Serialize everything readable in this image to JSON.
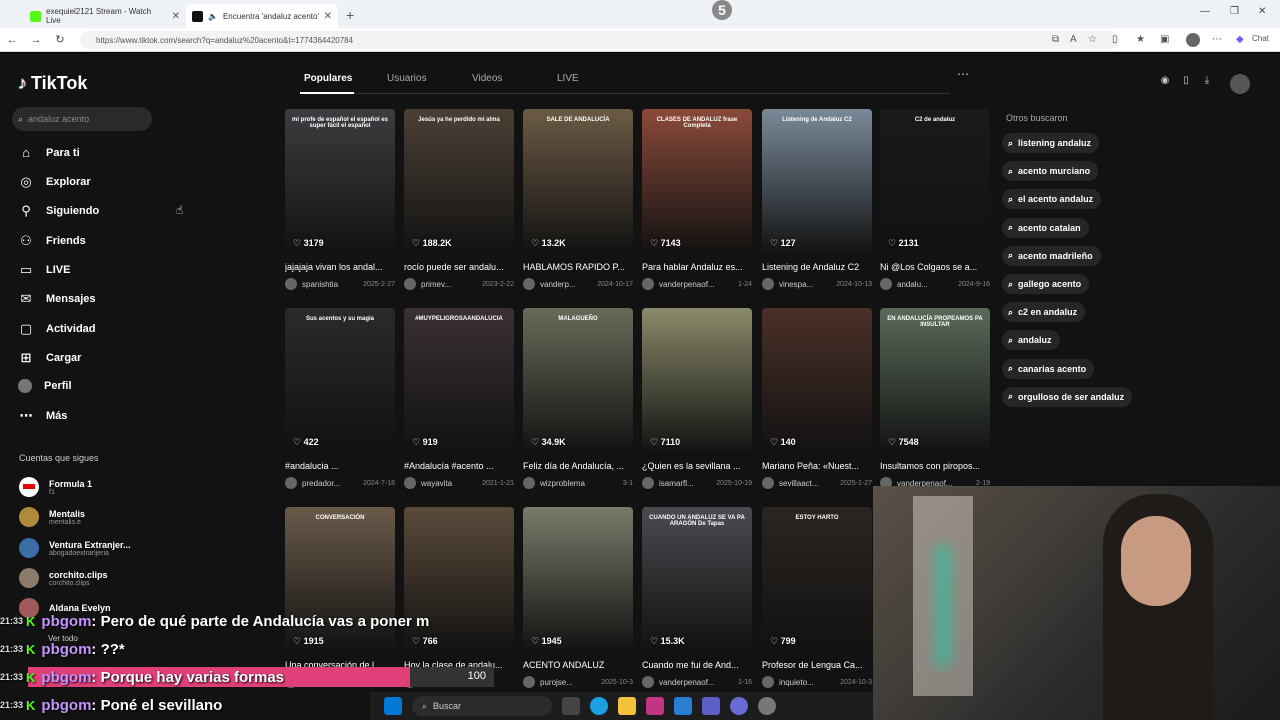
{
  "browser": {
    "tabs": [
      {
        "title": "exequiel2121 Stream - Watch Live",
        "favicon_color": "#53fc18"
      },
      {
        "title": "Encuentra 'andaluz acento' en",
        "favicon_color": "#111111"
      }
    ],
    "new_tab": "+",
    "url": "https://www.tiktok.com/search?q=andaluz%20acento&t=1774364420784",
    "overlay_number": "5",
    "profile_label": "Chat"
  },
  "app": {
    "logo": "TikTok",
    "search_placeholder": "andaluz acento",
    "nav": [
      {
        "label": "Para ti",
        "icon": "home-icon"
      },
      {
        "label": "Explorar",
        "icon": "compass-icon"
      },
      {
        "label": "Siguiendo",
        "icon": "user-follow-icon"
      },
      {
        "label": "Friends",
        "icon": "friends-icon"
      },
      {
        "label": "LIVE",
        "icon": "live-icon"
      },
      {
        "label": "Mensajes",
        "icon": "message-icon"
      },
      {
        "label": "Actividad",
        "icon": "activity-icon"
      },
      {
        "label": "Cargar",
        "icon": "upload-icon"
      },
      {
        "label": "Perfil",
        "icon": "profile-icon"
      },
      {
        "label": "Más",
        "icon": "more-icon"
      }
    ],
    "following_heading": "Cuentas que sigues",
    "following": [
      {
        "name": "Formula 1",
        "handle": "f1",
        "color": "#ffffff"
      },
      {
        "name": "Mentalis",
        "handle": "mentalis.e",
        "color": "#b08a3a"
      },
      {
        "name": "Ventura Extranjer...",
        "handle": "abogadoextranjeria",
        "color": "#3a6ea5"
      },
      {
        "name": "corchito.clips",
        "handle": "corchito.clips",
        "color": "#8c7a6b"
      },
      {
        "name": "Aldana Evelyn",
        "handle": "",
        "color": "#a05a5a"
      }
    ],
    "see_all": "Ver todo",
    "tabs": [
      "Populares",
      "Usuarios",
      "Videos",
      "LIVE"
    ],
    "others_heading": "Otros buscaron",
    "others": [
      "listening andaluz",
      "acento murciano",
      "el acento andaluz",
      "acento catalan",
      "acento madrileño",
      "gallego acento",
      "c2 en andaluz",
      "andaluz",
      "canarias acento",
      "orgulloso de ser andaluz"
    ],
    "videos": [
      {
        "likes": "3179",
        "caption": "jajajaja vivan los andal...",
        "author": "spanishtia",
        "date": "2025-2-27",
        "bg": "#3b3d40",
        "overlay": "mi profe de español el español es super fácil el español"
      },
      {
        "likes": "188.2K",
        "caption": "rocío puede ser andalu...",
        "author": "primev...",
        "date": "2023-2-22",
        "bg": "#4a4035",
        "overlay": "Jesús ya he perdido mi alma"
      },
      {
        "likes": "13.2K",
        "caption": "HABLAMOS RAPIDO P...",
        "author": "vanderp...",
        "date": "2024-10-17",
        "bg": "#6b5a45",
        "overlay": "SALE DE ANDALUCÍA"
      },
      {
        "likes": "7143",
        "caption": "Para hablar Andaluz es...",
        "author": "vanderpenaof...",
        "date": "1-24",
        "bg": "#8a4a3a",
        "overlay": "CLASES DE ANDALUZ frase Completa"
      },
      {
        "likes": "127",
        "caption": "Listening de Andaluz C2",
        "author": "vinespa...",
        "date": "2024-10-13",
        "bg": "#7a8a9a",
        "overlay": "Listening de Andaluz C2"
      },
      {
        "likes": "2131",
        "caption": "Ni @Los Colgaos se a...",
        "author": "andalu...",
        "date": "2024-9-16",
        "bg": "#1a1a1a",
        "overlay": "C2 de andaluz"
      },
      {
        "likes": "422",
        "caption": "#andalucia ...",
        "author": "predador...",
        "date": "2024-7-18",
        "bg": "#2a2a2a",
        "overlay": "Sus acentos y su magia"
      },
      {
        "likes": "919",
        "caption": "#Andalucía #acento ...",
        "author": "wayavita",
        "date": "2021-1-21",
        "bg": "#3a3035",
        "overlay": "#MUYPELIGROSAANDALUCIA"
      },
      {
        "likes": "34.9K",
        "caption": "Feliz día de Andalucía, ...",
        "author": "wizproblema",
        "date": "3-1",
        "bg": "#6a6a5a",
        "overlay": "MALAGUEÑO"
      },
      {
        "likes": "7110",
        "caption": "¿Quien es la sevillana ...",
        "author": "isamarfl...",
        "date": "2025-10-19",
        "bg": "#8a8a6a",
        "overlay": ""
      },
      {
        "likes": "140",
        "caption": "Mariano Peña: «Nuest...",
        "author": "sevillaact...",
        "date": "2025-1-27",
        "bg": "#4a3028",
        "overlay": ""
      },
      {
        "likes": "7548",
        "caption": "Insultamos con piropos...",
        "author": "vanderpenaof...",
        "date": "2-19",
        "bg": "#5a6a5a",
        "overlay": "EN ANDALUCÍA PROPEAMOS PA INSULTAR"
      },
      {
        "likes": "1915",
        "caption": "Una conversación de l...",
        "author": "",
        "date": "",
        "bg": "#6a5a4a",
        "overlay": "CONVERSACIÓN"
      },
      {
        "likes": "766",
        "caption": "Hoy la clase de andalu...",
        "author": "",
        "date": "",
        "bg": "#5a4a3a",
        "overlay": ""
      },
      {
        "likes": "1945",
        "caption": "ACENTO ANDALUZ",
        "author": "purojse...",
        "date": "2025-10-3",
        "bg": "#7a7a6a",
        "overlay": ""
      },
      {
        "likes": "15.3K",
        "caption": "Cuando me fui de And...",
        "author": "vanderpenaof...",
        "date": "1-16",
        "bg": "#4a4a50",
        "overlay": "CUANDO UN ANDALUZ SE VA PA ARAGÓN De Tapas"
      },
      {
        "likes": "799",
        "caption": "Profesor de Lengua Ca...",
        "author": "inquieto...",
        "date": "2024-10-3",
        "bg": "#2a2520",
        "overlay": "ESTOY HARTO"
      }
    ]
  },
  "chat": [
    {
      "time": "21:33",
      "user": "pbgom",
      "msg": ": Pero de qué parte de Andalucía vas a poner m"
    },
    {
      "time": "21:33",
      "user": "pbgom",
      "msg": ": ??*"
    },
    {
      "time": "21:33",
      "user": "pbgom",
      "msg": ": Porque hay varias formas"
    },
    {
      "time": "21:33",
      "user": "pbgom",
      "msg": ": Poné el sevillano"
    }
  ],
  "poll_value": "100",
  "taskbar": {
    "search": "Buscar"
  }
}
